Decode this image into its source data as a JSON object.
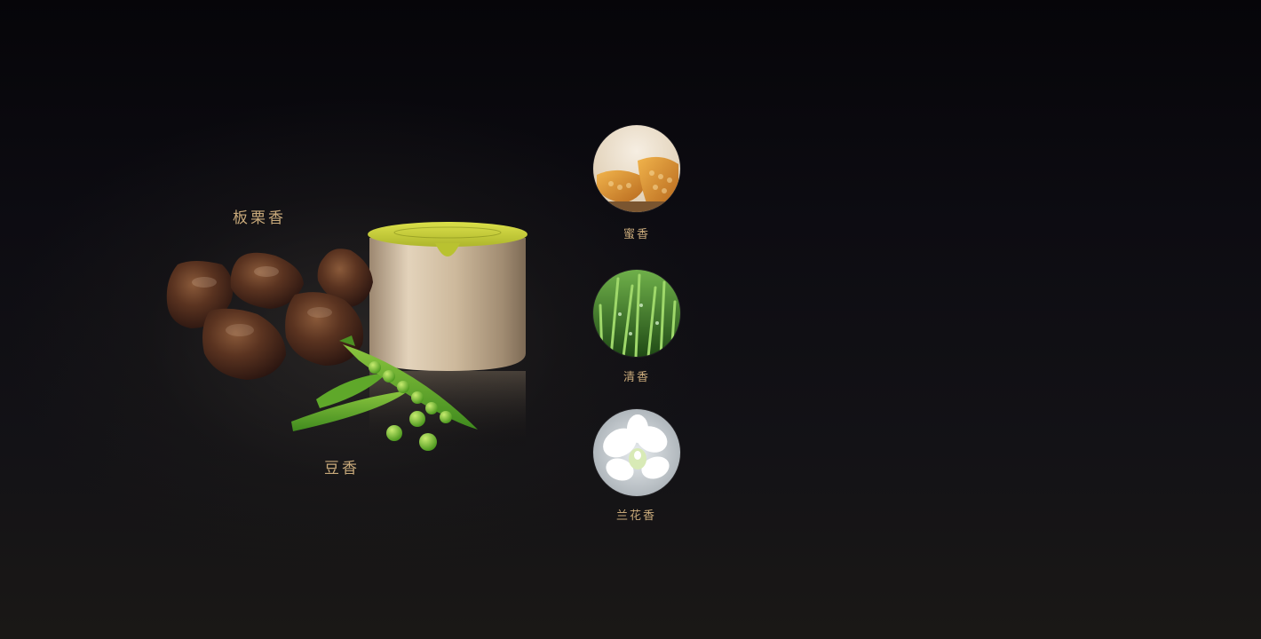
{
  "scene": {
    "left_labels": {
      "chestnut": "板栗香",
      "pea": "豆香"
    },
    "aromas": [
      {
        "label": "蜜香",
        "icon": "honeycomb-icon"
      },
      {
        "label": "清香",
        "icon": "grass-icon"
      },
      {
        "label": "兰花香",
        "icon": "orchid-icon"
      }
    ],
    "colors": {
      "label": "#c8a97a",
      "cap": "#c9d23a",
      "tin": "#c9b497"
    }
  }
}
